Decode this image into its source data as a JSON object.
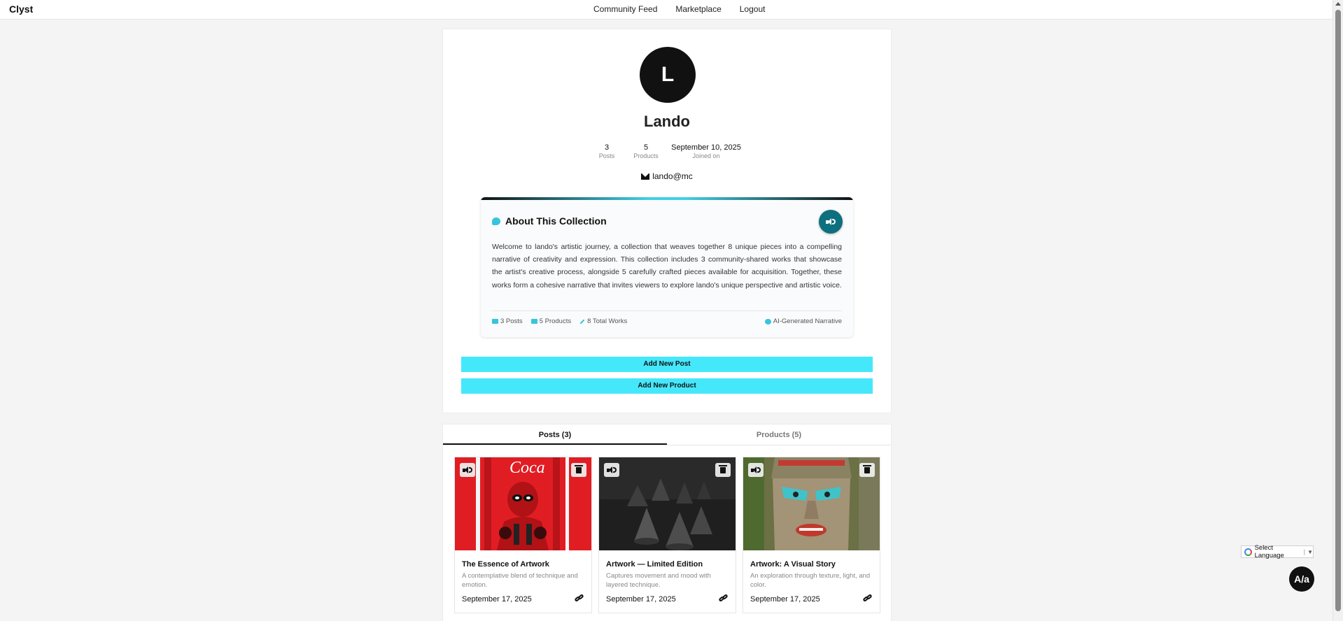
{
  "app": {
    "brand": "Clyst"
  },
  "nav": {
    "items": [
      "Community Feed",
      "Marketplace",
      "Logout"
    ]
  },
  "profile": {
    "avatar_letter": "L",
    "name": "Lando",
    "stats": [
      {
        "value": "3",
        "label": "Posts"
      },
      {
        "value": "5",
        "label": "Products"
      },
      {
        "value": "September 10, 2025",
        "label": "Joined on"
      }
    ],
    "email": "lando@mc"
  },
  "about": {
    "title": "About This Collection",
    "text": "Welcome to lando's artistic journey, a collection that weaves together 8 unique pieces into a compelling narrative of creativity and expression. This collection includes 3 community-shared works that showcase the artist's creative process, alongside 5 carefully crafted pieces available for acquisition. Together, these works form a cohesive narrative that invites viewers to explore lando's unique perspective and artistic voice.",
    "meta": [
      "3 Posts",
      "5 Products",
      "8 Total Works"
    ],
    "ai_note": "AI-Generated Narrative"
  },
  "actions": {
    "add_post": "Add New Post",
    "add_product": "Add New Product"
  },
  "tabs": {
    "posts": "Posts (3)",
    "products": "Products (5)"
  },
  "posts": [
    {
      "title": "The Essence of Artwork",
      "description": "A contemplative blend of technique and emotion.",
      "date": "September 17, 2025"
    },
    {
      "title": "Artwork — Limited Edition",
      "description": "Captures movement and mood with layered technique.",
      "date": "September 17, 2025"
    },
    {
      "title": "Artwork: A Visual Story",
      "description": "An exploration through texture, light, and color.",
      "date": "September 17, 2025"
    }
  ],
  "language": {
    "label": "Select Language",
    "caret": "▼"
  },
  "a11y": {
    "label": "A/a"
  },
  "colors": {
    "accent": "#45e8fb",
    "teal": "#0e6f7e",
    "dark": "#111111"
  }
}
